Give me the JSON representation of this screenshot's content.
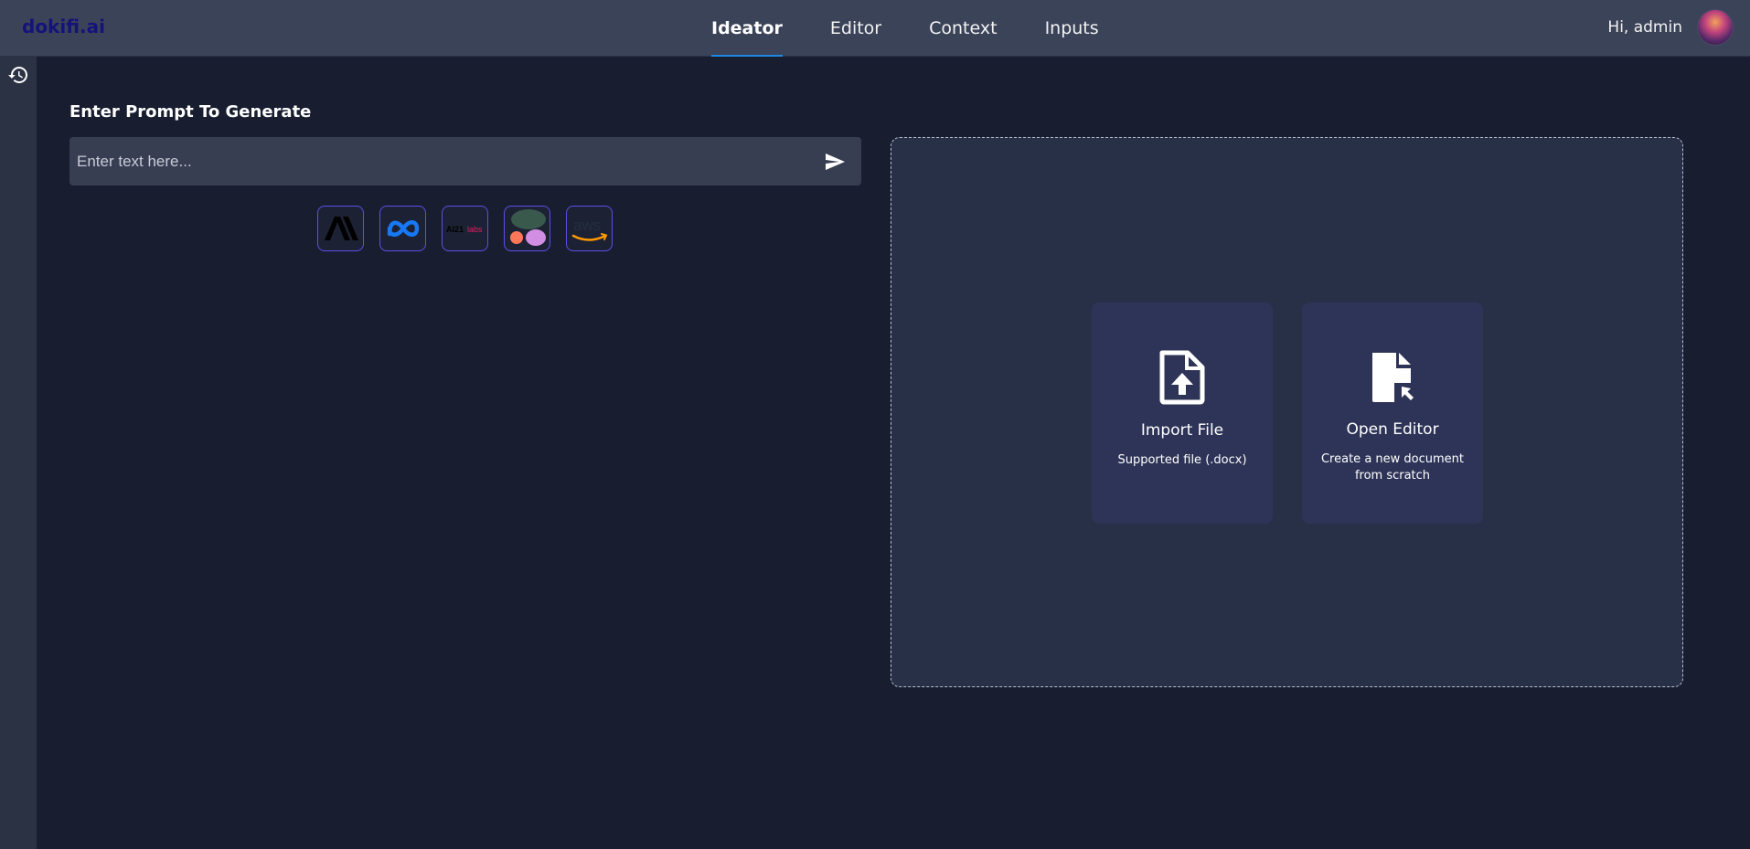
{
  "app": {
    "logo": "dokifi.ai"
  },
  "nav": {
    "tabs": [
      {
        "label": "Ideator",
        "active": true
      },
      {
        "label": "Editor",
        "active": false
      },
      {
        "label": "Context",
        "active": false
      },
      {
        "label": "Inputs",
        "active": false
      }
    ]
  },
  "user": {
    "greeting": "Hi, admin"
  },
  "sidebar": {
    "icon": "history-icon"
  },
  "prompt": {
    "title": "Enter Prompt To Generate",
    "placeholder": "Enter text here...",
    "value": "",
    "send_icon": "send-icon"
  },
  "models": [
    {
      "name": "anthropic",
      "icon": "anthropic-logo-icon"
    },
    {
      "name": "meta",
      "icon": "meta-logo-icon"
    },
    {
      "name": "ai21",
      "icon": "ai21-labs-logo-icon",
      "text": "AI21",
      "text2": "labs"
    },
    {
      "name": "cohere",
      "icon": "cohere-logo-icon"
    },
    {
      "name": "aws",
      "icon": "aws-logo-icon",
      "text": "aws"
    }
  ],
  "actions": {
    "import": {
      "title": "Import File",
      "description": "Supported file (.docx)",
      "icon": "file-upload-icon"
    },
    "editor": {
      "title": "Open Editor",
      "description": "Create a new document from scratch",
      "icon": "file-pointer-icon"
    }
  },
  "colors": {
    "background": "#181e30",
    "topbar": "#3b4358",
    "accent": "#1e88e5",
    "model_border": "#5b4fe8",
    "card": "#2e3457"
  }
}
